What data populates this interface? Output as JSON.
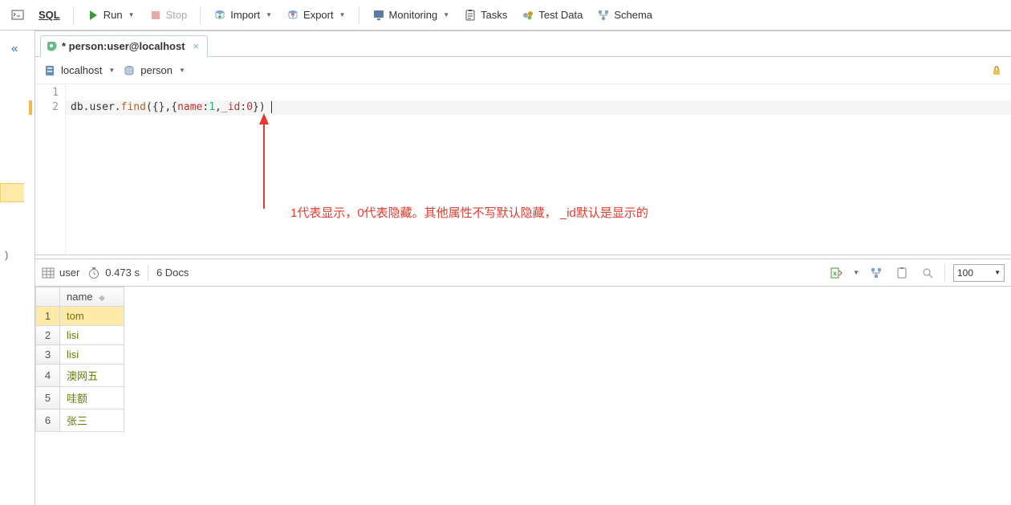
{
  "toolbar": {
    "sql": "SQL",
    "run": "Run",
    "stop": "Stop",
    "import": "Import",
    "export": "Export",
    "monitoring": "Monitoring",
    "tasks": "Tasks",
    "test_data": "Test Data",
    "schema": "Schema"
  },
  "tab": {
    "title": "* person:user@localhost"
  },
  "conn": {
    "host": "localhost",
    "db": "person"
  },
  "editor": {
    "line1_no": "1",
    "line2_no": "2",
    "code_plain_a": "db.user.",
    "code_func": "find",
    "code_plain_b": "({},{",
    "code_key_a": "name",
    "code_plain_c": ":",
    "code_num_a": "1",
    "code_plain_d": ",",
    "code_key_b": "_id",
    "code_plain_e": ":",
    "code_num_b": "0",
    "code_plain_f": "})"
  },
  "annotation": "1代表显示，0代表隐藏。其他属性不写默认隐藏， _id默认是显示的",
  "result": {
    "collection": "user",
    "time": "0.473 s",
    "docs": "6 Docs",
    "page_size": "100",
    "column": "name",
    "rows": [
      {
        "n": "1",
        "name": "tom"
      },
      {
        "n": "2",
        "name": "lisi"
      },
      {
        "n": "3",
        "name": "lisi"
      },
      {
        "n": "4",
        "name": "澳网五"
      },
      {
        "n": "5",
        "name": "哇额"
      },
      {
        "n": "6",
        "name": "张三"
      }
    ]
  }
}
